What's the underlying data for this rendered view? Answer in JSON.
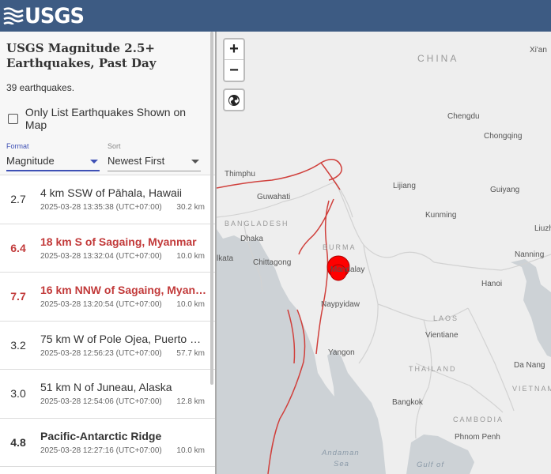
{
  "header": {
    "logo_text": "USGS"
  },
  "panel": {
    "title": "USGS Magnitude 2.5+ Earthquakes, Past Day",
    "count": "39 earthquakes.",
    "only_list_label": "Only List Earthquakes Shown on Map",
    "format": {
      "caption": "Format",
      "value": "Magnitude"
    },
    "sort": {
      "caption": "Sort",
      "value": "Newest First"
    }
  },
  "earthquakes": [
    {
      "mag": "2.7",
      "place": "4 km SSW of Pāhala, Hawaii",
      "time": "2025-03-28 13:35:38 (UTC+07:00)",
      "depth": "30.2 km"
    },
    {
      "mag": "6.4",
      "place": "18 km S of Sagaing, Myanmar",
      "time": "2025-03-28 13:32:04 (UTC+07:00)",
      "depth": "10.0 km"
    },
    {
      "mag": "7.7",
      "place": "16 km NNW of Sagaing, Myanmar",
      "time": "2025-03-28 13:20:54 (UTC+07:00)",
      "depth": "10.0 km"
    },
    {
      "mag": "3.2",
      "place": "75 km W of Pole Ojea, Puerto Rico",
      "time": "2025-03-28 12:56:23 (UTC+07:00)",
      "depth": "57.7 km"
    },
    {
      "mag": "3.0",
      "place": "51 km N of Juneau, Alaska",
      "time": "2025-03-28 12:54:06 (UTC+07:00)",
      "depth": "12.8 km"
    },
    {
      "mag": "4.8",
      "place": "Pacific-Antarctic Ridge",
      "time": "2025-03-28 12:27:16 (UTC+07:00)",
      "depth": "10.0 km"
    }
  ],
  "map": {
    "labels": {
      "china": "CHINA",
      "xian": "Xi'an",
      "chengdu": "Chengdu",
      "chongqing": "Chongqing",
      "thimphu": "Thimphu",
      "lijiang": "Lijiang",
      "guiyang": "Guiyang",
      "guwahati": "Guwahati",
      "kunming": "Kunming",
      "liuzhou": "Liuzh",
      "bangladesh": "BANGLADESH",
      "dhaka": "Dhaka",
      "burma": "BURMA",
      "nanning": "Nanning",
      "kolkata": "lkata",
      "chittagong": "Chittagong",
      "mandalay": "Mandalay",
      "hanoi": "Hanoi",
      "naypyidaw": "Naypyidaw",
      "laos": "LAOS",
      "vientiane": "Vientiane",
      "yangon": "Yangon",
      "thailand": "THAILAND",
      "danang": "Da Nang",
      "vietnam": "VIETNAM",
      "bangkok": "Bangkok",
      "cambodia": "CAMBODIA",
      "phnompenh": "Phnom Penh",
      "andaman": "Andaman",
      "sea": "Sea",
      "gulfof": "Gulf of"
    },
    "zoom_in": "+",
    "zoom_out": "−",
    "colors": {
      "land": "#eeeeee",
      "water": "#cdd2d6",
      "fault": "#d0403c",
      "quake": "#ff0000"
    }
  }
}
